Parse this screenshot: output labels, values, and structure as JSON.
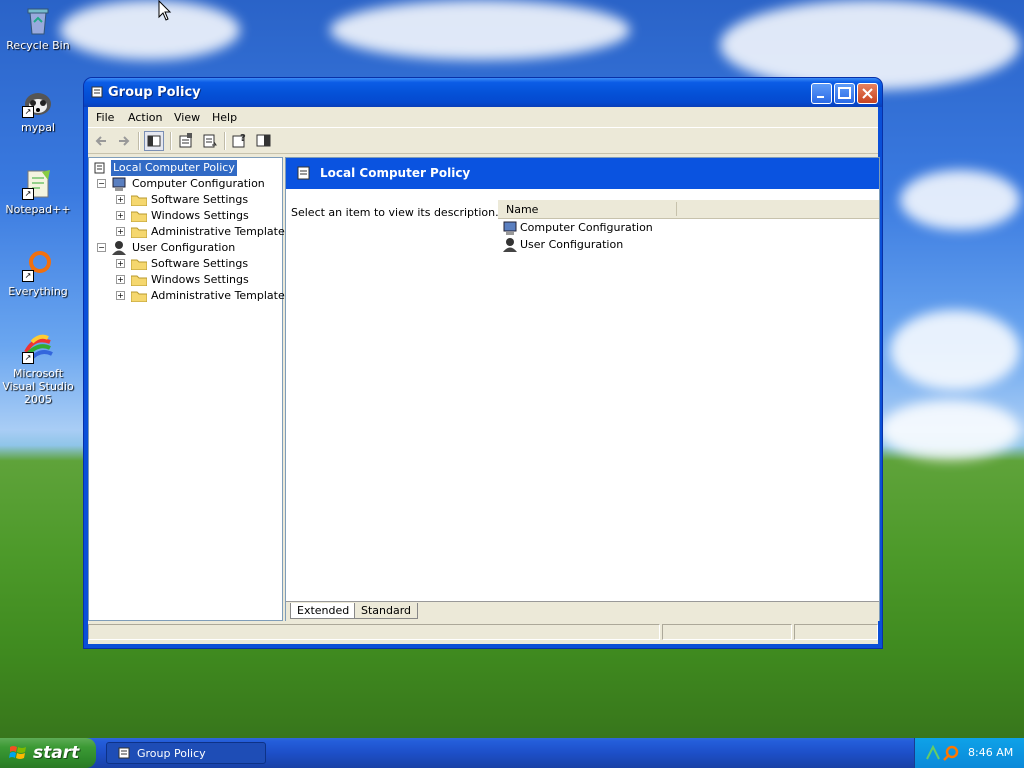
{
  "desktop": {
    "icons": [
      {
        "label": "Recycle Bin"
      },
      {
        "label": "mypal"
      },
      {
        "label": "Notepad++"
      },
      {
        "label": "Everything"
      },
      {
        "label": "Microsoft Visual Studio 2005"
      }
    ]
  },
  "window": {
    "title": "Group Policy",
    "menu": [
      "File",
      "Action",
      "View",
      "Help"
    ],
    "tree": {
      "root": "Local Computer Policy",
      "computer": "Computer Configuration",
      "computer_children": [
        "Software Settings",
        "Windows Settings",
        "Administrative Templates"
      ],
      "user": "User Configuration",
      "user_children": [
        "Software Settings",
        "Windows Settings",
        "Administrative Templates"
      ]
    },
    "right": {
      "header": "Local Computer Policy",
      "description": "Select an item to view its description.",
      "column_name": "Name",
      "items": [
        "Computer Configuration",
        "User Configuration"
      ],
      "tabs": [
        "Extended",
        "Standard"
      ]
    }
  },
  "taskbar": {
    "start_label": "start",
    "task_label": "Group Policy",
    "clock": "8:46 AM"
  },
  "colors": {
    "titlebar": "#0552d8",
    "selection": "#316ac5",
    "pane_header": "#0a53e0"
  }
}
